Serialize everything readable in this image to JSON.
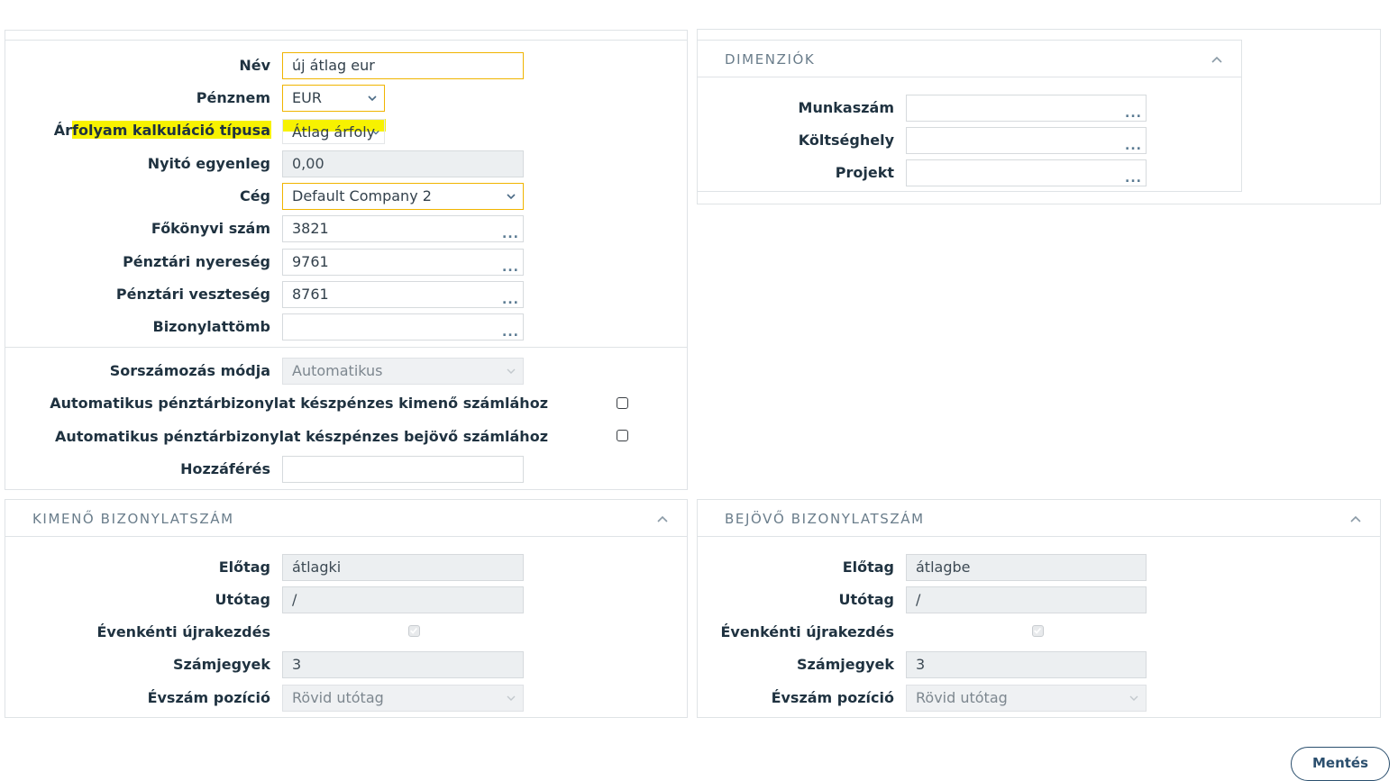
{
  "main": {
    "fields": {
      "nev": {
        "label": "Név",
        "value": "új átlag eur"
      },
      "penznem": {
        "label": "Pénznem",
        "value": "EUR"
      },
      "arfolyam": {
        "label": "Árfolyam kalkuláció típusa",
        "value": "Átlag árfoly"
      },
      "nyito": {
        "label": "Nyitó egyenleg",
        "value": "0,00"
      },
      "ceg": {
        "label": "Cég",
        "value": "Default Company 2"
      },
      "fokonyvi": {
        "label": "Főkönyvi szám",
        "value": "3821"
      },
      "nyereseg": {
        "label": "Pénztári nyereség",
        "value": "9761"
      },
      "veszteseg": {
        "label": "Pénztári veszteség",
        "value": "8761"
      },
      "bizonylattomb": {
        "label": "Bizonylattömb",
        "value": ""
      },
      "sorszamozas": {
        "label": "Sorszámozás módja",
        "value": "Automatikus"
      },
      "auto_kimeno": {
        "label": "Automatikus pénztárbizonylat készpénzes kimenő számlához",
        "checked": false
      },
      "auto_bejovo": {
        "label": "Automatikus pénztárbizonylat készpénzes bejövő számlához",
        "checked": false
      },
      "hozzaferes": {
        "label": "Hozzáférés",
        "value": ""
      }
    }
  },
  "dimenziok": {
    "title": "DIMENZIÓK",
    "fields": {
      "munkaszam": {
        "label": "Munkaszám",
        "value": ""
      },
      "koltseghely": {
        "label": "Költséghely",
        "value": ""
      },
      "projekt": {
        "label": "Projekt",
        "value": ""
      }
    }
  },
  "kimeno": {
    "title": "KIMENŐ BIZONYLATSZÁM",
    "elotag": {
      "label": "Előtag",
      "value": "átlagki"
    },
    "utotag": {
      "label": "Utótag",
      "value": "/"
    },
    "ujrakezdes": {
      "label": "Évenkénti újrakezdés",
      "checked": true
    },
    "szamjegyek": {
      "label": "Számjegyek",
      "value": "3"
    },
    "evszam": {
      "label": "Évszám pozíció",
      "value": "Rövid utótag"
    }
  },
  "bejovo": {
    "title": "BEJÖVŐ BIZONYLATSZÁM",
    "elotag": {
      "label": "Előtag",
      "value": "átlagbe"
    },
    "utotag": {
      "label": "Utótag",
      "value": "/"
    },
    "ujrakezdes": {
      "label": "Évenkénti újrakezdés",
      "checked": true
    },
    "szamjegyek": {
      "label": "Számjegyek",
      "value": "3"
    },
    "evszam": {
      "label": "Évszám pozíció",
      "value": "Rövid utótag"
    }
  },
  "ellipsis": "...",
  "save_label": "Mentés",
  "colors": {
    "highlight": "#f7f200",
    "focus_border": "#f0b400",
    "accent": "#2b4f6e"
  },
  "icons": {
    "collapse": "chevron-up-icon",
    "dropdown": "chevron-down-icon",
    "lookup": "ellipsis-icon"
  }
}
